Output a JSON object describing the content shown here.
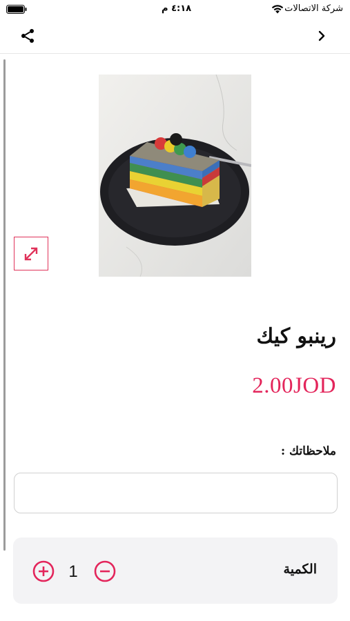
{
  "status_bar": {
    "carrier": "شركة الاتصالات",
    "time": "٤:١٨ م",
    "icons": [
      "wifi-icon",
      "battery-icon"
    ]
  },
  "nav_bar": {
    "back_icon": "chevron-right-icon",
    "share_icon": "share-icon"
  },
  "product": {
    "image_alt": "rainbow cake slice",
    "expand_icon": "expand-arrows-icon",
    "name": "رينبو كيك",
    "price": "2.00JOD"
  },
  "notes": {
    "label": "ملاحظاتك :",
    "value": "",
    "placeholder": ""
  },
  "quantity": {
    "label": "الكمية",
    "value": "1",
    "plus_icon": "plus-circle-icon",
    "minus_icon": "minus-circle-icon"
  },
  "colors": {
    "accent": "#e3255b",
    "text": "#111111",
    "card_bg": "#f3f3f5",
    "border": "#d0d0d0"
  }
}
